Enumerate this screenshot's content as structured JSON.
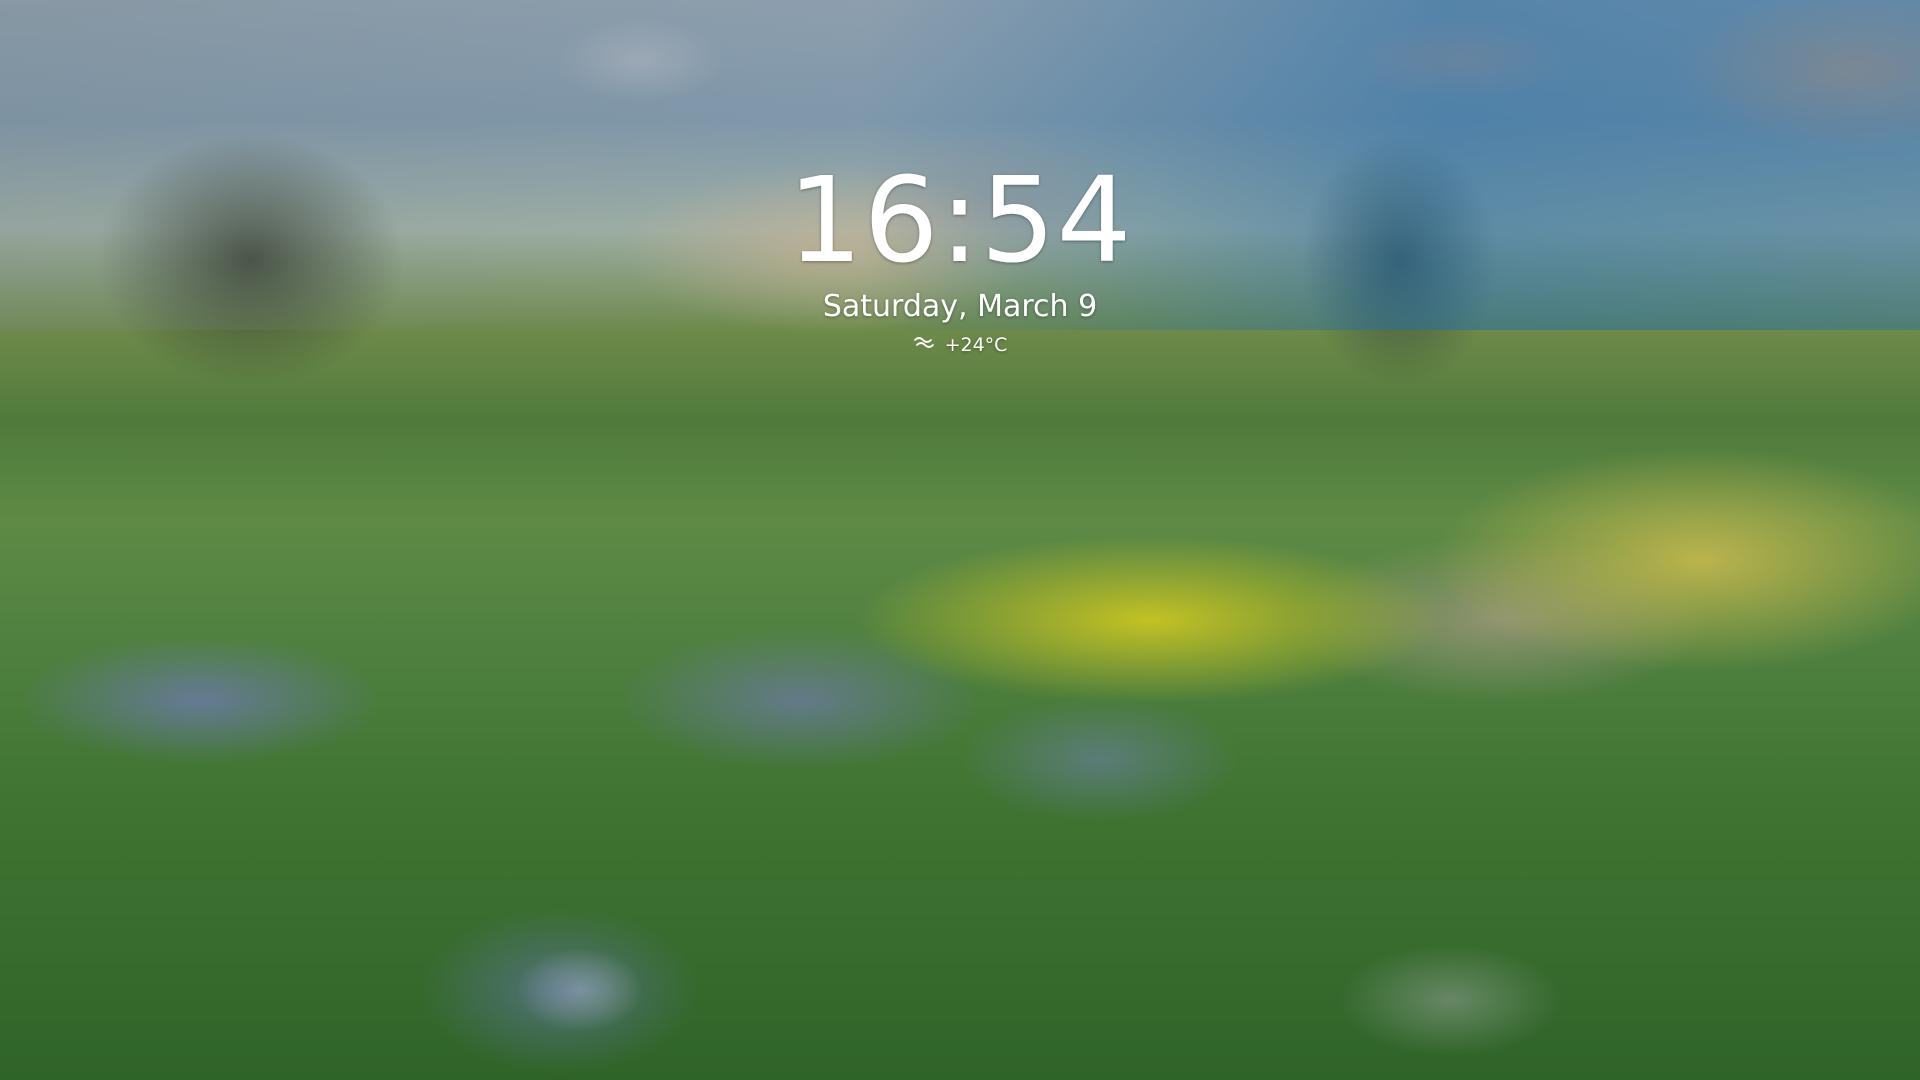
{
  "lockscreen": {
    "time": "16:54",
    "date": "Saturday, March 9",
    "weather": {
      "icon": "fog-icon",
      "temperature": "+24°C"
    }
  },
  "colors": {
    "text": "#ffffff"
  }
}
